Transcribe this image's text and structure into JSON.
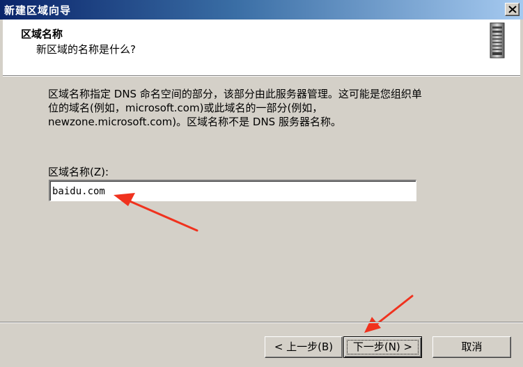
{
  "window": {
    "title": "新建区域向导"
  },
  "header": {
    "title": "区域名称",
    "subtitle": "新区域的名称是什么?"
  },
  "body": {
    "description_lines": [
      "区域名称指定 DNS 命名空间的部分，该部分由此服务器管理。这可能是您组织单",
      "位的域名(例如，microsoft.com)或此域名的一部分(例如，",
      "newzone.microsoft.com)。区域名称不是 DNS 服务器名称。"
    ],
    "zone_name_label": "区域名称(Z):",
    "zone_name_value": "baidu.com"
  },
  "buttons": {
    "back": "< 上一步(B)",
    "next": "下一步(N) >",
    "cancel": "取消"
  },
  "colors": {
    "annotation_arrow": "#f0321e",
    "titlebar_start": "#0a246a",
    "titlebar_end": "#a6caf0"
  },
  "icons": {
    "header_icon": "server-icon",
    "close": "close-icon"
  }
}
